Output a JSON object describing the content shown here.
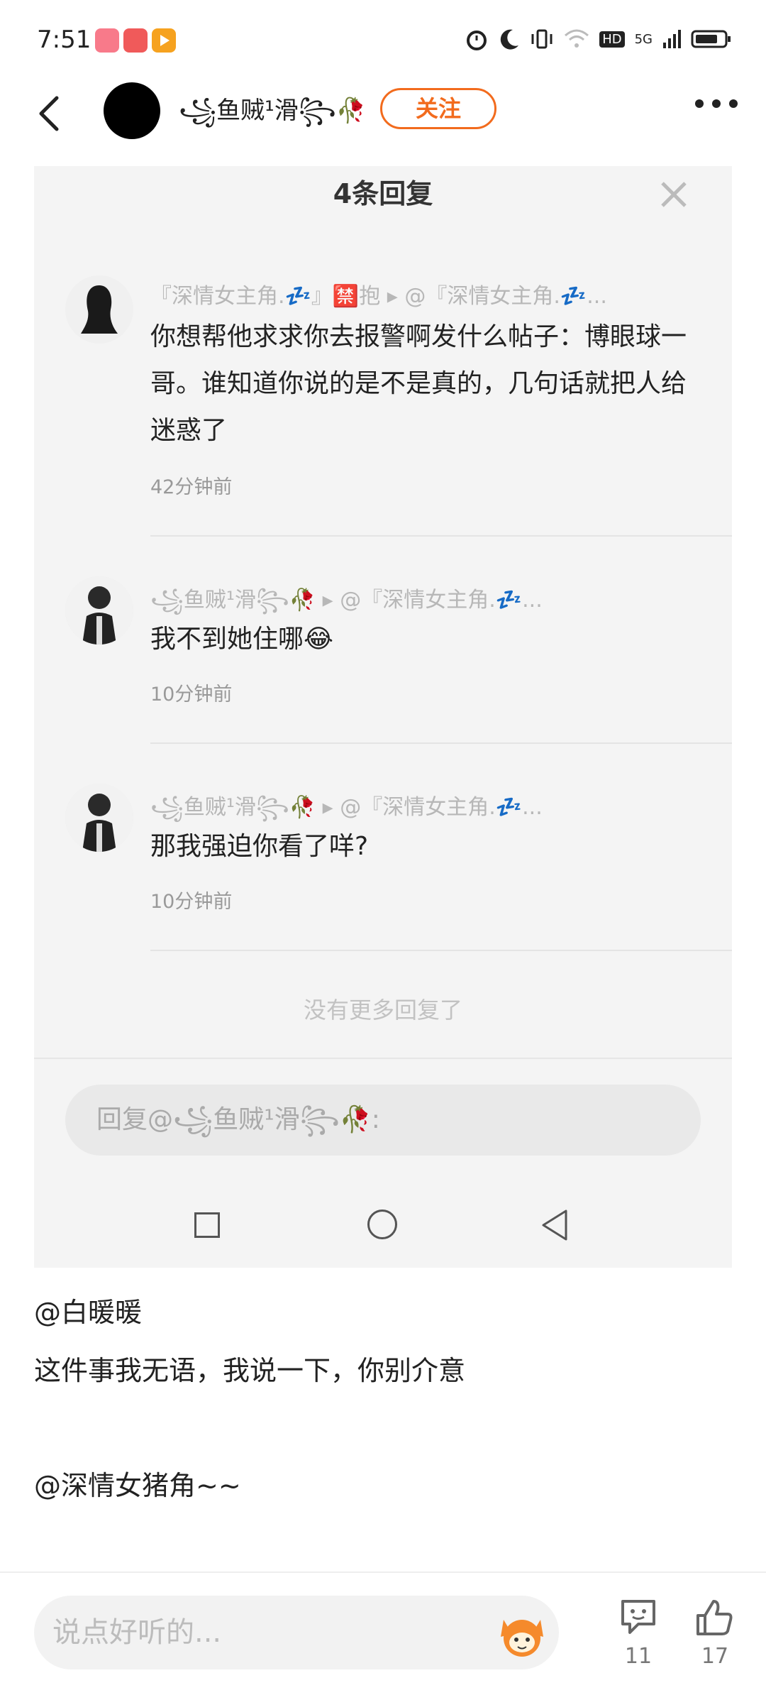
{
  "status_bar": {
    "time": "7:51",
    "right_icons": [
      "alarm-icon",
      "moon-icon",
      "vibrate-icon",
      "wifi-icon",
      "hd-icon",
      "signal-5g-icon",
      "battery-icon"
    ],
    "hd_label": "HD",
    "network_label": "5G"
  },
  "header": {
    "username": "꧁鱼贼¹滑꧂🥀",
    "follow_label": "关注"
  },
  "reply_panel": {
    "title": "4条回复",
    "replies": [
      {
        "meta": "『深情女主角.💤』🈲抱 ▸ @『深情女主角.💤...",
        "text": "你想帮他求求你去报警啊发什么帖子：博眼球一哥。谁知道你说的是不是真的，几句话就把人给迷惑了",
        "time": "42分钟前"
      },
      {
        "meta": "꧁鱼贼¹滑꧂🥀 ▸ @『深情女主角.💤...",
        "text": "我不到她住哪😂",
        "time": "10分钟前"
      },
      {
        "meta": "꧁鱼贼¹滑꧂🥀 ▸ @『深情女主角.💤...",
        "text": "那我强迫你看了咩?",
        "time": "10分钟前"
      }
    ],
    "no_more": "没有更多回复了",
    "reply_placeholder": "回复@꧁鱼贼¹滑꧂🥀:"
  },
  "post": {
    "line1": "@白暖暖",
    "line2": "这件事我无语，我说一下，你别介意",
    "line3": "@深情女猪角~~"
  },
  "bottom_bar": {
    "comment_placeholder": "说点好听的...",
    "comment_count": "11",
    "like_count": "17"
  },
  "colors": {
    "accent": "#f26b1d"
  }
}
